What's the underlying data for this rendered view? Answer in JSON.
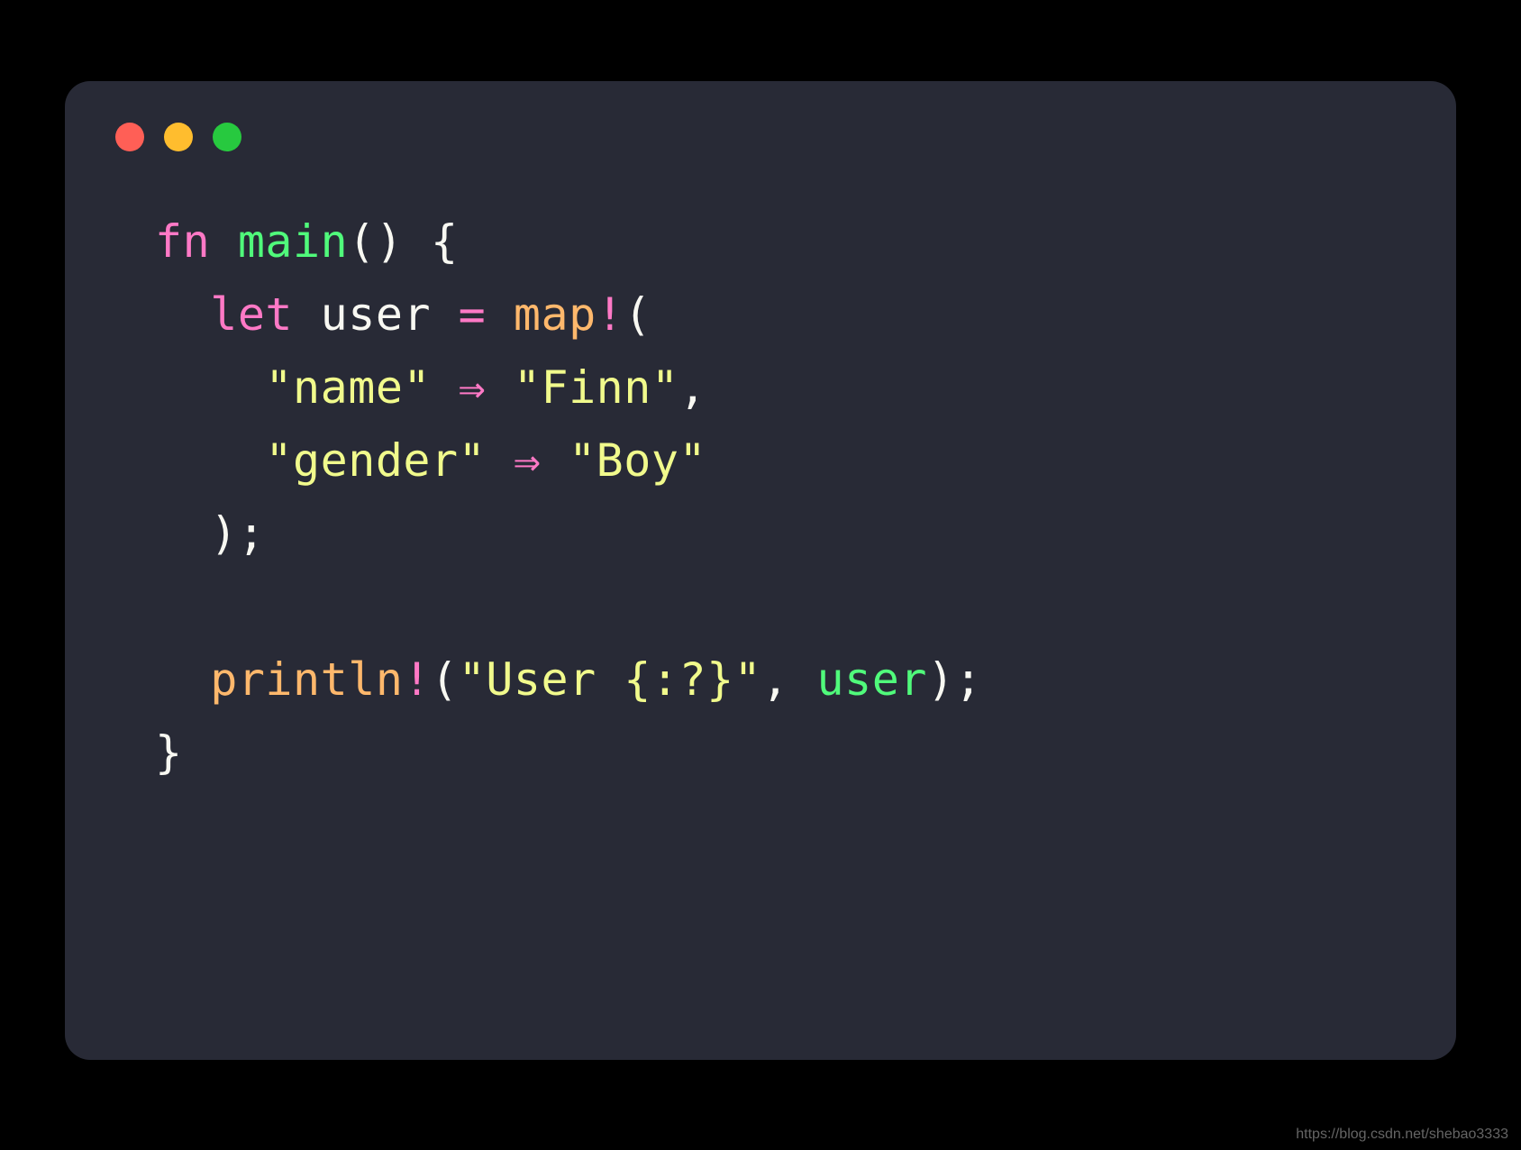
{
  "window": {
    "traffic_lights": [
      "red",
      "yellow",
      "green"
    ]
  },
  "code": {
    "tokens": [
      [
        {
          "t": "fn",
          "c": "keyword"
        },
        {
          "t": " ",
          "c": "punct"
        },
        {
          "t": "main",
          "c": "fn"
        },
        {
          "t": "() {",
          "c": "punct"
        }
      ],
      [
        {
          "t": "  ",
          "c": "punct"
        },
        {
          "t": "let",
          "c": "keyword"
        },
        {
          "t": " ",
          "c": "punct"
        },
        {
          "t": "user",
          "c": "var"
        },
        {
          "t": " ",
          "c": "punct"
        },
        {
          "t": "=",
          "c": "op"
        },
        {
          "t": " ",
          "c": "punct"
        },
        {
          "t": "map",
          "c": "macro"
        },
        {
          "t": "!",
          "c": "bang"
        },
        {
          "t": "(",
          "c": "punct"
        }
      ],
      [
        {
          "t": "    ",
          "c": "punct"
        },
        {
          "t": "\"name\"",
          "c": "string"
        },
        {
          "t": " ",
          "c": "punct"
        },
        {
          "t": "⇒",
          "c": "op"
        },
        {
          "t": " ",
          "c": "punct"
        },
        {
          "t": "\"Finn\"",
          "c": "string"
        },
        {
          "t": ",",
          "c": "punct"
        }
      ],
      [
        {
          "t": "    ",
          "c": "punct"
        },
        {
          "t": "\"gender\"",
          "c": "string"
        },
        {
          "t": " ",
          "c": "punct"
        },
        {
          "t": "⇒",
          "c": "op"
        },
        {
          "t": " ",
          "c": "punct"
        },
        {
          "t": "\"Boy\"",
          "c": "string"
        }
      ],
      [
        {
          "t": "  );",
          "c": "punct"
        }
      ],
      [
        {
          "t": "",
          "c": "punct"
        }
      ],
      [
        {
          "t": "  ",
          "c": "punct"
        },
        {
          "t": "println",
          "c": "macro"
        },
        {
          "t": "!",
          "c": "bang"
        },
        {
          "t": "(",
          "c": "punct"
        },
        {
          "t": "\"User {:?}\"",
          "c": "string"
        },
        {
          "t": ", ",
          "c": "punct"
        },
        {
          "t": "user",
          "c": "ident"
        },
        {
          "t": ");",
          "c": "punct"
        }
      ],
      [
        {
          "t": "}",
          "c": "punct"
        }
      ]
    ]
  },
  "watermark": "https://blog.csdn.net/shebao3333"
}
